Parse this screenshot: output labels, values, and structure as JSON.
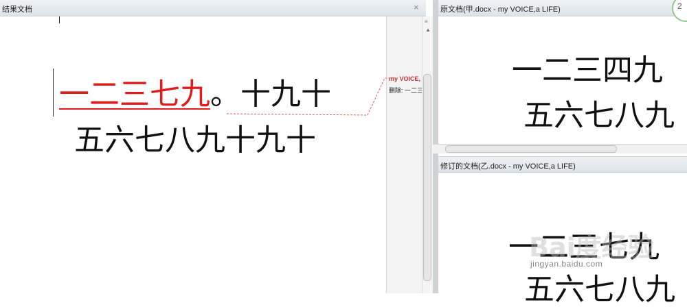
{
  "left_pane": {
    "title": "结果文档",
    "close_glyph": "×",
    "line1_inserted": "一二三七九",
    "line1_rest": "。十九十",
    "line2": "五六七八九十九十",
    "balloon": {
      "author": "my VOICE,",
      "text": "删除: 一二三"
    }
  },
  "scrollbar": {
    "up": "▲",
    "down": "▼",
    "grip": "≡"
  },
  "original_pane": {
    "title": "原文档(甲.docx - my VOICE,a LIFE)",
    "line1": "一二三四九",
    "line2": "五六七八九"
  },
  "revised_pane": {
    "title": "修订的文档(乙.docx - my VOICE,a LIFE)",
    "line1": "一二三七九",
    "line2": "五六七八九"
  },
  "badge": {
    "text": "2"
  },
  "watermark": {
    "logo": "Bai度经验",
    "url": "jingyan.baidu.com"
  },
  "colors": {
    "insertion": "#e21b1b",
    "balloon_author": "#c83232",
    "title_bar": "#e4e9ed"
  }
}
